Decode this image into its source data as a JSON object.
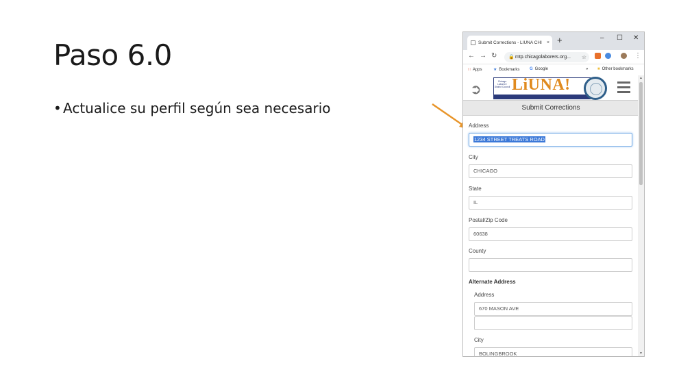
{
  "slide": {
    "title": "Paso 6.0",
    "bullet": "Actualice su perfil según sea necesario"
  },
  "browser": {
    "tab_title": "Submit Corrections - LIUNA CHI",
    "tab_close": "×",
    "new_tab": "+",
    "minimize": "–",
    "maximize": "☐",
    "close": "✕",
    "back": "←",
    "forward": "→",
    "reload": "↻",
    "url": "mtp.chicagolaborers.org...",
    "menu": "⋮",
    "bookmarks": {
      "apps": "Apps",
      "bookmarks": "Bookmarks",
      "google": "Google",
      "more": "»",
      "other": "Other bookmarks"
    }
  },
  "site": {
    "logo_text": "LiUNA!",
    "logo_sub": "Chicago Laborers' District Council",
    "page_title": "Submit Corrections"
  },
  "form": {
    "address_label": "Address",
    "address_value": "1234 STREET TREATS ROAD",
    "city_label": "City",
    "city_value": "CHICAGO",
    "state_label": "State",
    "state_value": "IL",
    "zip_label": "Postal/Zip Code",
    "zip_value": "60638",
    "county_label": "County",
    "county_value": "",
    "alt_section_label": "Alternate Address",
    "alt_address_label": "Address",
    "alt_address_value": "670 MASON AVE",
    "alt_address2_value": "",
    "alt_city_label": "City",
    "alt_city_value": "BOLINGBROOK"
  },
  "colors": {
    "arrow": "#e8952a",
    "selection": "#3b78d8",
    "logo_orange": "#e08a1e",
    "logo_blue": "#2b3a7a"
  }
}
